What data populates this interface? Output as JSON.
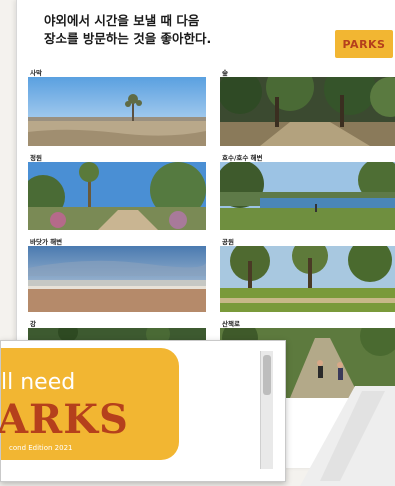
{
  "header": {
    "line1": "야외에서 시간을 보낼 때 다음",
    "line2": "장소를 방문하는 것을 좋아한다."
  },
  "logo": {
    "text": "PARKS"
  },
  "tiles": {
    "desert": "사막",
    "forest": "숲",
    "garden": "정원",
    "lake": "호수/호수 해변",
    "beach": "바닷가 해변",
    "park": "공원",
    "river": "강",
    "trail": "산책로"
  },
  "card": {
    "line1": "ll need",
    "big": "ARKS",
    "sub": "cond Edition 2021"
  },
  "colors": {
    "accent": "#f2b632",
    "brand": "#b5401c"
  }
}
